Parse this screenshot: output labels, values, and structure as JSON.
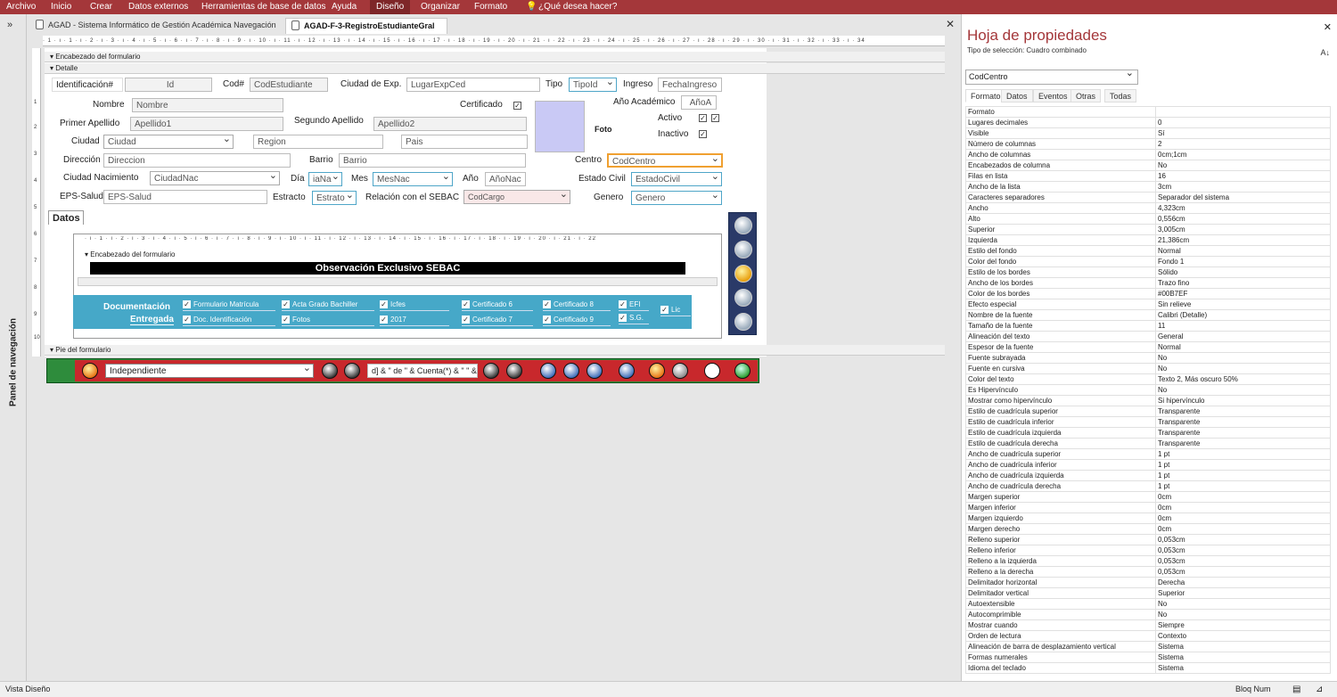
{
  "ribbon": {
    "items": [
      "Archivo",
      "Inicio",
      "Crear",
      "Datos externos",
      "Herramientas de base de datos",
      "Ayuda",
      "Diseño",
      "Organizar",
      "Formato",
      "¿Qué desea hacer?"
    ]
  },
  "nav_pane": {
    "label": "Panel de navegación",
    "toggle": "»"
  },
  "tabs": [
    {
      "label": "AGAD - Sistema Informático de Gestión Académica  Navegación"
    },
    {
      "label": "AGAD-F-3-RegistroEstudianteGral"
    }
  ],
  "ruler_text": "· 1 · ı · 1 · ı · 2 · ı · 3 · ı · 4 · ı · 5 · ı · 6 · ı · 7 · ı · 8 · ı · 9 · ı · 10 · ı · 11 · ı · 12 · ı · 13 · ı · 14 · ı · 15 · ı · 16 · ı · 17 · ı · 18 · ı · 19 · ı · 20 · ı · 21 · ı · 22 · ı · 23 · ı · 24 · ı · 25 · ı · 26 · ı · 27 · ı · 28 · ı · 29 · ı · 30 · ı · 31 · ı · 32 · ı · 33 · ı · 34",
  "sections": {
    "header": "Encabezado del formulario",
    "detail": "Detalle",
    "footer": "Pie del formulario"
  },
  "form": {
    "lbl_identificacion": "Identificación#",
    "fld_id": "Id",
    "lbl_cod": "Cod#",
    "fld_cod": "CodEstudiante",
    "lbl_ciudad_exp": "Ciudad de Exp.",
    "fld_ciudad_exp": "LugarExpCed",
    "lbl_tipo": "Tipo",
    "fld_tipo": "TipoId",
    "lbl_ingreso": "Ingreso",
    "fld_ingreso": "FechaIngreso",
    "lbl_nombre": "Nombre",
    "fld_nombre": "Nombre",
    "lbl_certificado": "Certificado",
    "lbl_anio_academico": "Año Académico",
    "fld_anio_academico": "AñoA",
    "lbl_primer_apellido": "Primer Apellido",
    "fld_apellido1": "Apellido1",
    "lbl_segundo_apellido": "Segundo Apellido",
    "fld_apellido2": "Apellido2",
    "lbl_activo": "Activo",
    "lbl_foto": "Foto",
    "lbl_ciudad": "Ciudad",
    "fld_ciudad": "Ciudad",
    "fld_region": "Region",
    "fld_pais": "Pais",
    "lbl_inactivo": "Inactivo",
    "lbl_direccion": "Dirección",
    "fld_direccion": "Direccion",
    "lbl_barrio": "Barrio",
    "fld_barrio": "Barrio",
    "lbl_centro": "Centro",
    "fld_centro": "CodCentro",
    "lbl_ciudad_nac": "Ciudad Nacimiento",
    "fld_ciudad_nac": "CiudadNac",
    "lbl_dia": "Día",
    "fld_dia": "iaNa",
    "lbl_mes": "Mes",
    "fld_mes": "MesNac",
    "lbl_anio": "Año",
    "fld_anio": "AñoNac",
    "lbl_estado_civil": "Estado Civil",
    "fld_estado_civil": "EstadoCivil",
    "lbl_eps": "EPS-Salud",
    "fld_eps": "EPS-Salud",
    "lbl_estracto": "Estracto",
    "fld_estrato": "Estrato",
    "lbl_relacion": "Relación con el SEBAC",
    "fld_codcargo": "CodCargo",
    "lbl_genero": "Genero",
    "fld_genero": "Genero",
    "lbl_datos": "Datos"
  },
  "subform": {
    "ruler": "· ı · 1 · ı · 2 · ı · 3 · ı · 4 · ı · 5 · ı · 6 · ı · 7 · ı · 8 · ı · 9 · ı · 10 · ı · 11 · ı · 12 · ı · 13 · ı · 14 · ı · 15 · ı · 16 · ı · 17 · ı · 18 · ı · 19 · ı · 20 · ı · 21 · ı · 22",
    "header": "Encabezado del formulario",
    "banner": "Observación Exclusivo SEBAC"
  },
  "documentacion": {
    "label1": "Documentación",
    "label2": "Entregada",
    "checks": [
      "Formulario Matrícula",
      "Acta Grado Bachiller",
      "Icfes",
      "Certificado 6",
      "Certificado 8",
      "EFI",
      "Lic",
      "Doc. Identificación",
      "Fotos",
      "2017",
      "Certificado 7",
      "Certificado 9",
      "S.G."
    ]
  },
  "footer": {
    "combo": "Independiente",
    "expr": "d] & \" de \" & Cuenta(*) & \" \" &"
  },
  "property_sheet": {
    "title": "Hoja de propiedades",
    "selection_type": "Tipo de selección:  Cuadro combinado",
    "selected": "CodCentro",
    "tabs": [
      "Formato",
      "Datos",
      "Eventos",
      "Otras",
      "Todas"
    ],
    "rows": [
      [
        "Formato",
        ""
      ],
      [
        "Lugares decimales",
        "0"
      ],
      [
        "Visible",
        "Sí"
      ],
      [
        "Número de columnas",
        "2"
      ],
      [
        "Ancho de columnas",
        "0cm;1cm"
      ],
      [
        "Encabezados de columna",
        "No"
      ],
      [
        "Filas en lista",
        "16"
      ],
      [
        "Ancho de la lista",
        "3cm"
      ],
      [
        "Caracteres separadores",
        "Separador del sistema"
      ],
      [
        "Ancho",
        "4,323cm"
      ],
      [
        "Alto",
        "0,556cm"
      ],
      [
        "Superior",
        "3,005cm"
      ],
      [
        "Izquierda",
        "21,386cm"
      ],
      [
        "Estilo del fondo",
        "Normal"
      ],
      [
        "Color del fondo",
        "Fondo 1"
      ],
      [
        "Estilo de los bordes",
        "Sólido"
      ],
      [
        "Ancho de los bordes",
        "Trazo fino"
      ],
      [
        "Color de los bordes",
        "#00B7EF"
      ],
      [
        "Efecto especial",
        "Sin relieve"
      ],
      [
        "Nombre de la fuente",
        "Calibri (Detalle)"
      ],
      [
        "Tamaño de la fuente",
        "11"
      ],
      [
        "Alineación del texto",
        "General"
      ],
      [
        "Espesor de la fuente",
        "Normal"
      ],
      [
        "Fuente subrayada",
        "No"
      ],
      [
        "Fuente en cursiva",
        "No"
      ],
      [
        "Color del texto",
        "Texto 2, Más oscuro 50%"
      ],
      [
        "Es Hipervínculo",
        "No"
      ],
      [
        "Mostrar como hipervínculo",
        "Si hipervínculo"
      ],
      [
        "Estilo de cuadrícula superior",
        "Transparente"
      ],
      [
        "Estilo de cuadrícula inferior",
        "Transparente"
      ],
      [
        "Estilo de cuadrícula izquierda",
        "Transparente"
      ],
      [
        "Estilo de cuadrícula derecha",
        "Transparente"
      ],
      [
        "Ancho de cuadrícula superior",
        "1 pt"
      ],
      [
        "Ancho de cuadrícula inferior",
        "1 pt"
      ],
      [
        "Ancho de cuadrícula izquierda",
        "1 pt"
      ],
      [
        "Ancho de cuadrícula derecha",
        "1 pt"
      ],
      [
        "Margen superior",
        "0cm"
      ],
      [
        "Margen inferior",
        "0cm"
      ],
      [
        "Margen izquierdo",
        "0cm"
      ],
      [
        "Margen derecho",
        "0cm"
      ],
      [
        "Relleno superior",
        "0,053cm"
      ],
      [
        "Relleno inferior",
        "0,053cm"
      ],
      [
        "Relleno a la izquierda",
        "0,053cm"
      ],
      [
        "Relleno a la derecha",
        "0,053cm"
      ],
      [
        "Delimitador horizontal",
        "Derecha"
      ],
      [
        "Delimitador vertical",
        "Superior"
      ],
      [
        "Autoextensible",
        "No"
      ],
      [
        "Autocomprimible",
        "No"
      ],
      [
        "Mostrar cuando",
        "Siempre"
      ],
      [
        "Orden de lectura",
        "Contexto"
      ],
      [
        "Alineación de barra de desplazamiento vertical",
        "Sistema"
      ],
      [
        "Formas numerales",
        "Sistema"
      ],
      [
        "Idioma del teclado",
        "Sistema"
      ]
    ]
  },
  "status": {
    "left": "Vista Diseño",
    "right": "Bloq Num"
  },
  "colors": {
    "accent": "#a4373a",
    "border_sel": "#00B7EF"
  }
}
